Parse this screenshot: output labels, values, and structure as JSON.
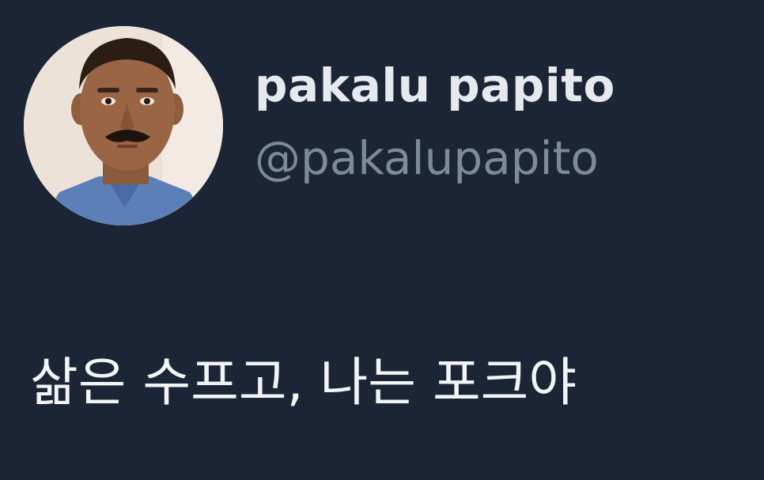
{
  "tweet": {
    "author": {
      "display_name": "pakalu papito",
      "handle": "@pakalupapito",
      "avatar_icon": "profile-photo"
    },
    "text": "삶은 수프고, 나는 포크야"
  },
  "colors": {
    "background": "#1b2535",
    "name": "#e6e9ed",
    "handle": "#7d8a99",
    "text": "#f2f4f6"
  }
}
